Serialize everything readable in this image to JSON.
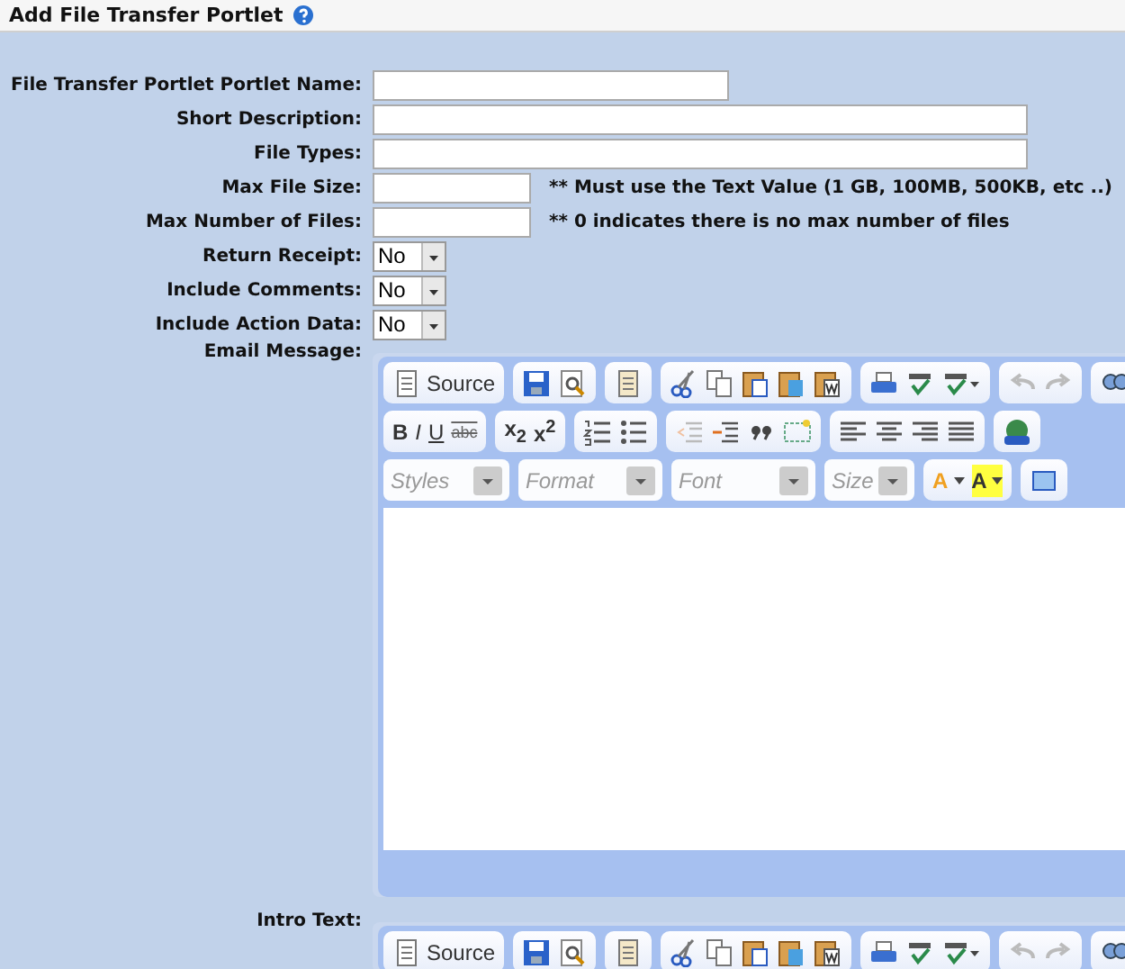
{
  "header": {
    "title": "Add File Transfer Portlet"
  },
  "fields": [
    {
      "label": "File Transfer Portlet Portlet Name:",
      "kind": "medium"
    },
    {
      "label": "Short Description:",
      "kind": "long"
    },
    {
      "label": "File Types:",
      "kind": "long"
    },
    {
      "label": "Max File Size:",
      "kind": "short",
      "hint": "** Must use the Text Value (1 GB, 100MB, 500KB, etc ..)"
    },
    {
      "label": "Max Number of Files:",
      "kind": "short",
      "hint": "** 0 indicates there is no max number of files"
    },
    {
      "label": "Return Receipt:",
      "kind": "select",
      "value": "No"
    },
    {
      "label": "Include Comments:",
      "kind": "select",
      "value": "No"
    },
    {
      "label": "Include Action Data:",
      "kind": "select",
      "value": "No"
    }
  ],
  "editors": [
    {
      "label": "Email Message:",
      "source": "Source",
      "format_glyphs": [
        "B",
        "I",
        "U",
        "abc"
      ],
      "script_glyphs": [
        "x$_{2}$",
        "x$^{2}$"
      ],
      "combos": [
        "Styles",
        "Format",
        "Font",
        "Size"
      ],
      "color_glyphs": [
        "A",
        "A"
      ]
    },
    {
      "label": "Intro Text:",
      "source": "Source"
    }
  ]
}
